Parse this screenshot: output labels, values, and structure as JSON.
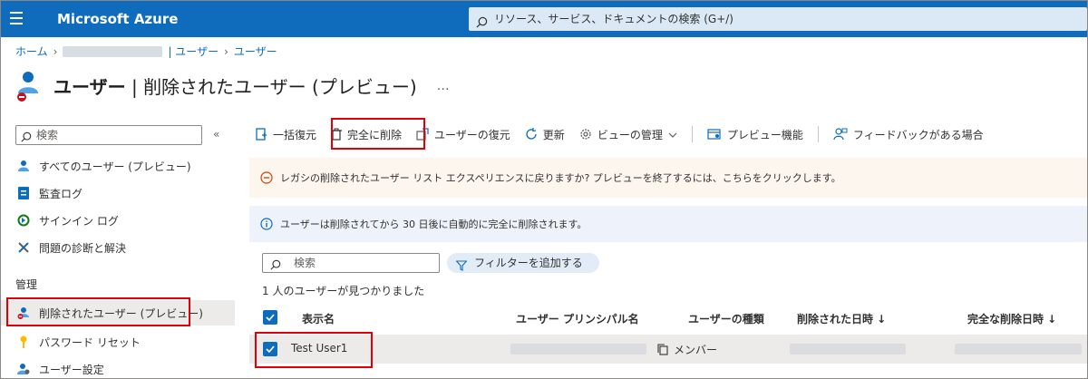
{
  "topbar": {
    "brand": "Microsoft Azure",
    "search_placeholder": "リソース、サービス、ドキュメントの検索 (G+/)"
  },
  "breadcrumb": {
    "home": "ホーム",
    "users_1": "| ユーザー",
    "users_2": "ユーザー"
  },
  "page": {
    "title_main": "ユーザー",
    "title_sep": " | ",
    "title_sub": "削除されたユーザー (プレビュー)",
    "more": "…"
  },
  "leftnav": {
    "search_placeholder": "検索",
    "collapse": "«",
    "items": [
      {
        "label": "すべてのユーザー (プレビュー)"
      },
      {
        "label": "監査ログ"
      },
      {
        "label": "サインイン ログ"
      },
      {
        "label": "問題の診断と解決"
      }
    ],
    "section_label": "管理",
    "manage_items": [
      {
        "label": "削除されたユーザー (プレビュー)"
      },
      {
        "label": "パスワード リセット"
      },
      {
        "label": "ユーザー設定"
      }
    ]
  },
  "toolbar": {
    "bulk_restore": "一括復元",
    "delete_permanently": "完全に削除",
    "restore_users": "ユーザーの復元",
    "refresh": "更新",
    "manage_view": "ビューの管理",
    "preview_features": "プレビュー機能",
    "feedback": "フィードバックがある場合"
  },
  "banners": {
    "warning": "レガシの削除されたユーザー リスト エクスペリエンスに戻りますか? プレビューを終了するには、こちらをクリックします。",
    "info": "ユーザーは削除されてから 30 日後に自動的に完全に削除されます。"
  },
  "list": {
    "search_placeholder": "検索",
    "add_filter": "フィルターを追加する",
    "count_text": "1 人のユーザーが見つかりました",
    "columns": {
      "display_name": "表示名",
      "upn": "ユーザー プリンシパル名",
      "user_type": "ユーザーの種類",
      "deleted_at": "削除された日時 ↓",
      "permanent_delete": "完全な削除日時 ↓"
    },
    "rows": [
      {
        "display_name": "Test User1",
        "user_type": "メンバー"
      }
    ]
  },
  "colors": {
    "azure_blue": "#0f6cbd",
    "highlight_red": "#e0000a"
  }
}
